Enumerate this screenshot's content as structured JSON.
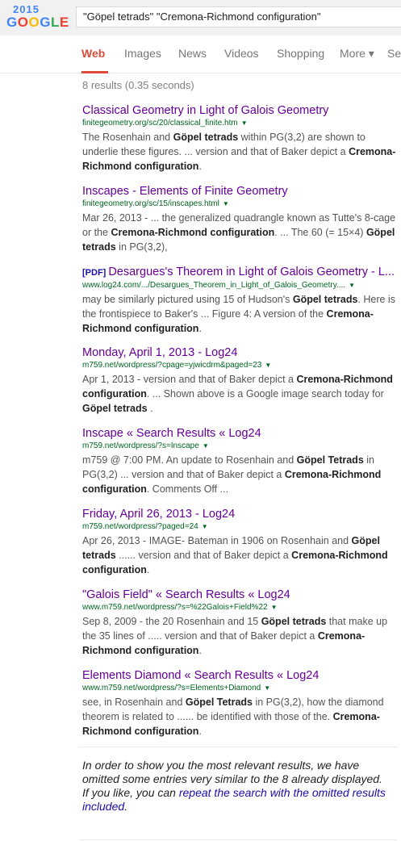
{
  "logo": {
    "year": "2015",
    "letters": [
      "G",
      "O",
      "O",
      "G",
      "L",
      "E"
    ],
    "alt": "GOOGLE"
  },
  "search": {
    "query": "\"Göpel tetrads\" \"Cremona-Richmond configuration\""
  },
  "tabs": [
    {
      "label": "Web",
      "active": true
    },
    {
      "label": "Images"
    },
    {
      "label": "News"
    },
    {
      "label": "Videos"
    },
    {
      "label": "Shopping"
    },
    {
      "label": "More ▾"
    },
    {
      "label": "Se"
    }
  ],
  "stats": "8 results (0.35 seconds)",
  "results": [
    {
      "title": "Classical Geometry in Light of Galois Geometry",
      "url": "finitegeometry.org/sc/20/classical_finite.htm",
      "snippet_html": "The Rosenhain and <b>Göpel tetrads</b> within PG(3,2) are shown to underlie these figures. ... version and that of Baker depict a <b>Cremona-Richmond configuration</b>."
    },
    {
      "title": "Inscapes - Elements of Finite Geometry",
      "url": "finitegeometry.org/sc/15/inscapes.html",
      "snippet_html": "Mar 26, 2013 - ... the generalized quadrangle known as Tutte's 8-cage or the <b>Cremona-Richmond configuration</b>. ... The 60 (= 15×4) <b>Göpel tetrads</b> in PG(3,2),"
    },
    {
      "pdf": "[PDF]",
      "title": "Desargues's Theorem in Light of Galois Geometry - L...",
      "url": "www.log24.com/.../Desargues_Theorem_in_Light_of_Galois_Geometry....",
      "snippet_html": "may be similarly pictured using 15 of Hudson's <b>Göpel tetrads</b>. Here is the frontispiece to Baker's ... Figure 4: A version of the <b>Cremona-Richmond configuration</b>."
    },
    {
      "title": "Monday, April 1, 2013 - Log24",
      "url": "m759.net/wordpress/?cpage=yjwicdrm&paged=23",
      "snippet_html": "Apr 1, 2013 - version and that of Baker depict a <b>Cremona-Richmond configuration</b>. ... Shown above is a Google image search today for <b>Göpel tetrads</b> ."
    },
    {
      "title": "Inscape « Search Results « Log24",
      "url": "m759.net/wordpress/?s=Inscape",
      "snippet_html": "m759 @ 7:00 PM. An update to Rosenhain and <b>Göpel Tetrads</b> in PG(3,2) ... version and that of Baker depict a <b>Cremona-Richmond configuration</b>. Comments Off ..."
    },
    {
      "title": "Friday, April 26, 2013 - Log24",
      "url": "m759.net/wordpress/?paged=24",
      "snippet_html": "Apr 26, 2013 - IMAGE- Bateman in 1906 on Rosenhain and <b>Göpel tetrads</b> ...... version and that of Baker depict a <b>Cremona-Richmond configuration</b>."
    },
    {
      "title": "\"Galois Field\" « Search Results « Log24",
      "url": "www.m759.net/wordpress/?s=%22Galois+Field%22",
      "snippet_html": "Sep 8, 2009 - the 20 Rosenhain and 15 <b>Göpel tetrads</b> that make up the 35 lines of ..... version and that of Baker depict a <b>Cremona-Richmond configuration</b>."
    },
    {
      "title": "Elements Diamond « Search Results « Log24",
      "url": "www.m759.net/wordpress/?s=Elements+Diamond",
      "snippet_html": "see, in Rosenhain and <b>Göpel Tetrads</b> in PG(3,2), how the diamond theorem is related to ...... be identified with those of the. <b>Cremona-Richmond configuration</b>."
    }
  ],
  "omitted": {
    "text": "In order to show you the most relevant results, we have omitted some entries very similar to the 8 already displayed.",
    "prefix": "If you like, you can ",
    "link": "repeat the search with the omitted results included",
    "suffix": "."
  },
  "colors": {
    "accent": "#dd4b39",
    "visited_link": "#660099",
    "url_green": "#006621",
    "link_blue": "#1a0dab"
  }
}
